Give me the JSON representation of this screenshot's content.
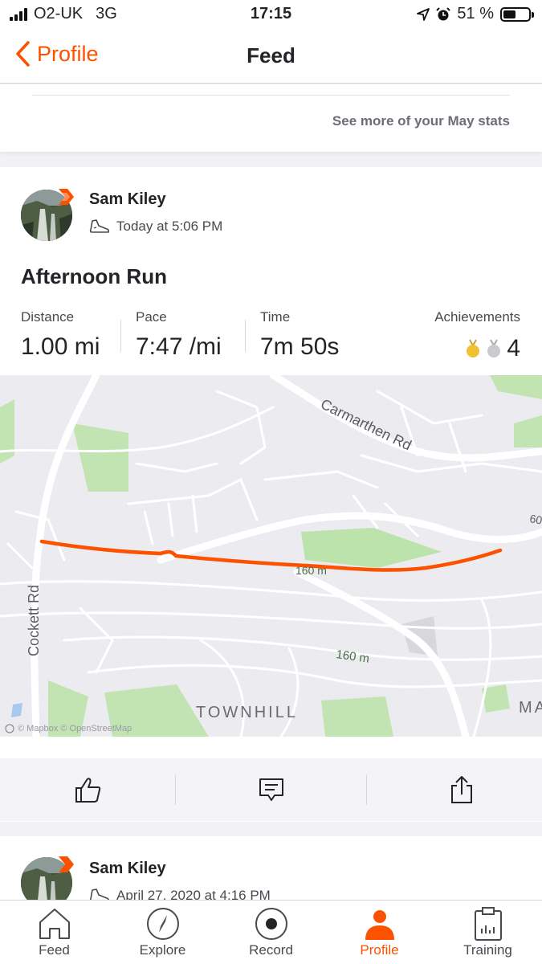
{
  "status_bar": {
    "carrier": "O2-UK",
    "network": "3G",
    "time": "17:15",
    "battery": "51 %",
    "battery_fraction": 0.51
  },
  "nav": {
    "back_label": "Profile",
    "title": "Feed"
  },
  "stats_card": {
    "link": "See more of your May stats"
  },
  "activity": {
    "athlete": "Sam Kiley",
    "time": "Today at 5:06 PM",
    "title": "Afternoon Run",
    "stats": [
      {
        "label": "Distance",
        "value": "1.00 mi"
      },
      {
        "label": "Pace",
        "value": "7:47 /mi"
      },
      {
        "label": "Time",
        "value": "7m 50s"
      }
    ],
    "achievements": {
      "label": "Achievements",
      "count": "4",
      "medals": [
        "gold",
        "silver"
      ]
    },
    "map": {
      "labels": {
        "road1": "Carmarthen Rd",
        "road2": "Cockett Rd",
        "area": "TOWNHILL",
        "elev1": "160 m",
        "elev2": "60",
        "elev3": "160 m",
        "edge": "MA"
      },
      "attribution": "© Mapbox © OpenStreetMap",
      "route_color": "#fc5200"
    },
    "actions": {
      "kudos_icon": "thumbs-up-icon",
      "comment_icon": "comment-icon",
      "share_icon": "share-icon"
    }
  },
  "next_activity": {
    "athlete": "Sam Kiley",
    "time": "April 27, 2020 at 4:16 PM"
  },
  "tab_bar": [
    {
      "label": "Feed",
      "icon": "home-icon"
    },
    {
      "label": "Explore",
      "icon": "compass-icon"
    },
    {
      "label": "Record",
      "icon": "record-icon"
    },
    {
      "label": "Profile",
      "icon": "person-icon",
      "active": true
    },
    {
      "label": "Training",
      "icon": "clipboard-icon"
    }
  ],
  "colors": {
    "accent": "#fc5200",
    "text": "#242428",
    "muted": "#494950"
  }
}
